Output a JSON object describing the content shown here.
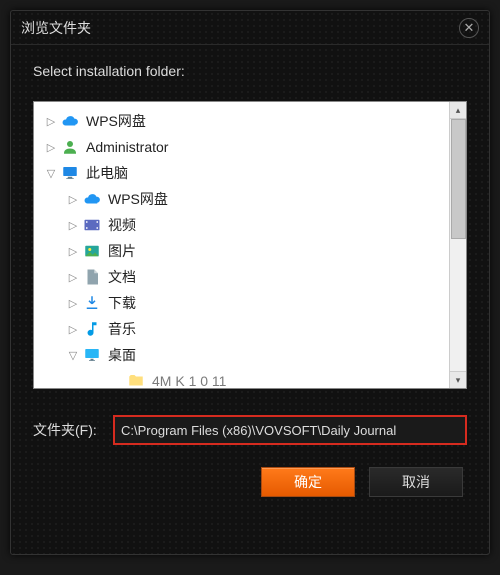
{
  "dialog": {
    "title": "浏览文件夹",
    "prompt": "Select installation folder:"
  },
  "tree": {
    "wps_root": "WPS网盘",
    "admin": "Administrator",
    "this_pc": "此电脑",
    "wps_child": "WPS网盘",
    "videos": "视频",
    "pictures": "图片",
    "documents": "文档",
    "downloads": "下载",
    "music": "音乐",
    "desktop": "桌面",
    "truncated_item": "4M  K    1 0 11"
  },
  "path": {
    "label": "文件夹(F):",
    "value": "C:\\Program Files (x86)\\VOVSOFT\\Daily Journal"
  },
  "buttons": {
    "ok": "确定",
    "cancel": "取消"
  }
}
